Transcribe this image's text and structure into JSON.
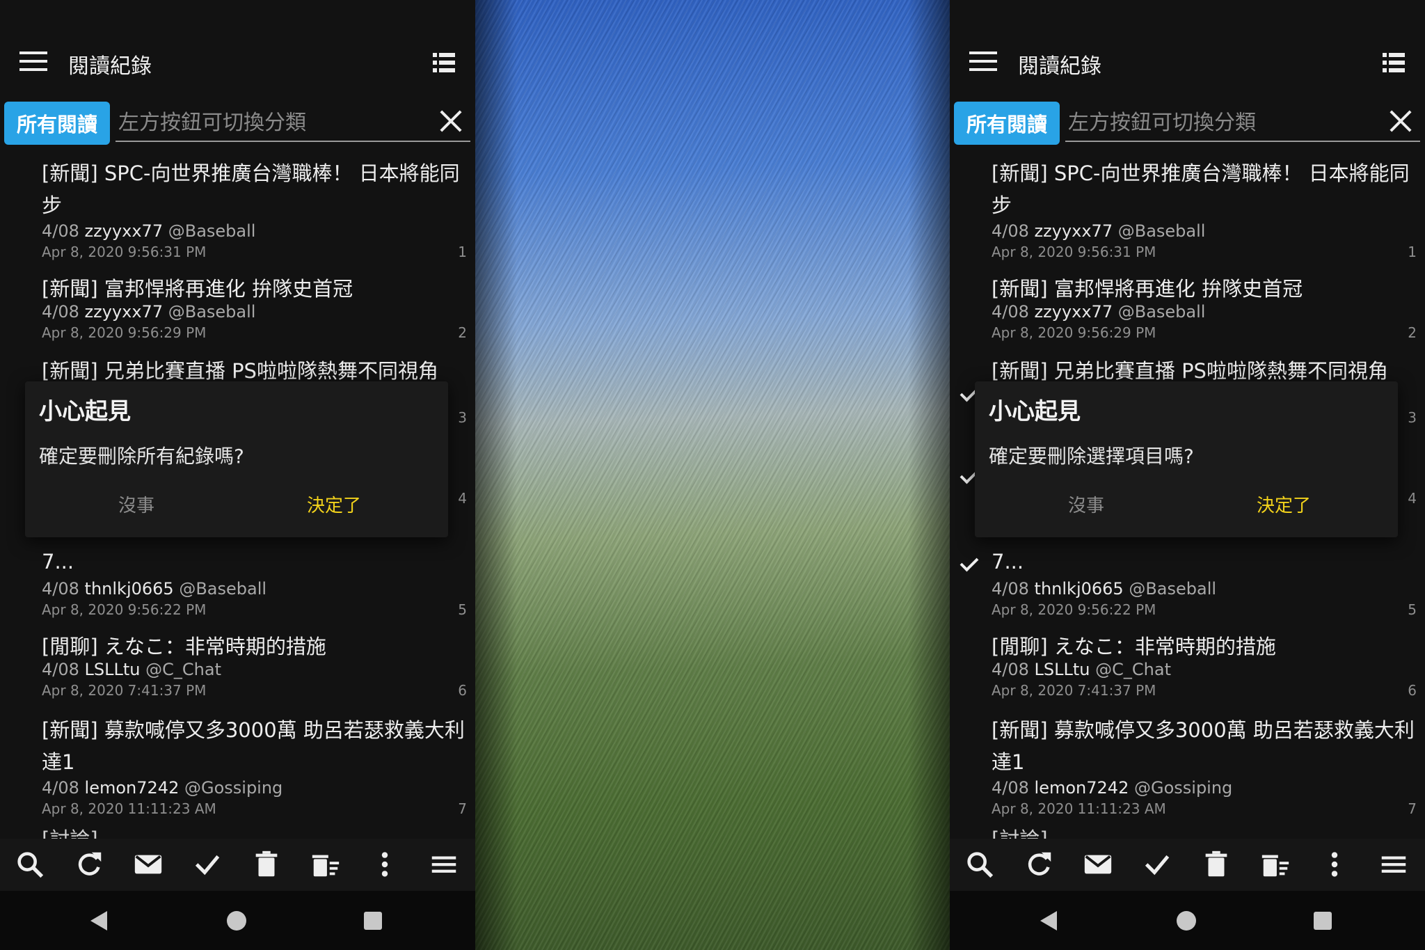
{
  "header": {
    "title": "閱讀紀錄"
  },
  "filter": {
    "category_label": "所有閱讀",
    "placeholder": "左方按鈕可切換分類"
  },
  "items": [
    {
      "title_line1": "[新聞] SPC-向世界推廣台灣職棒！ 日本將能同",
      "title_line2": "步",
      "date": "4/08",
      "author": "zzyyxx77",
      "board": "@Baseball",
      "time": "Apr 8, 2020 9:56:31 PM",
      "index": "1"
    },
    {
      "title_line1": "[新聞] 富邦悍將再進化 拚隊史首冠",
      "title_line2": "",
      "date": "4/08",
      "author": "zzyyxx77",
      "board": "@Baseball",
      "time": "Apr 8, 2020 9:56:29 PM",
      "index": "2"
    },
    {
      "title_line1": "[新聞] 兄弟比賽直播 PS啦啦隊熱舞不同視角",
      "title_line2": "",
      "date": "",
      "author": "",
      "board": "",
      "time": "",
      "index": "3"
    },
    {
      "title_line1": "",
      "title_line2": "",
      "date": "",
      "author": "",
      "board": "",
      "time": "",
      "index": "4"
    },
    {
      "title_line1": "",
      "title_line2": "7...",
      "date": "4/08",
      "author": "thnlkj0665",
      "board": "@Baseball",
      "time": "Apr 8, 2020 9:56:22 PM",
      "index": "5"
    },
    {
      "title_line1": "[閒聊] えなこ：非常時期的措施",
      "title_line2": "",
      "date": "4/08",
      "author": "LSLLtu",
      "board": "@C_Chat",
      "time": "Apr 8, 2020 7:41:37 PM",
      "index": "6"
    },
    {
      "title_line1": "[新聞] 募款喊停又多3000萬 助呂若瑟救義大利",
      "title_line2": "達1",
      "date": "4/08",
      "author": "lemon7242",
      "board": "@Gossiping",
      "time": "Apr 8, 2020 11:11:23 AM",
      "index": "7"
    }
  ],
  "dialogs": {
    "left": {
      "title": "小心起見",
      "message": "確定要刪除所有紀錄嗎?",
      "cancel": "沒事",
      "confirm": "決定了"
    },
    "right": {
      "title": "小心起見",
      "message": "確定要刪除選擇項目嗎?",
      "cancel": "沒事",
      "confirm": "決定了"
    }
  },
  "toolbar_icons": [
    "search-icon",
    "refresh-icon",
    "mail-icon",
    "check-icon",
    "delete-icon",
    "delete-sweep-icon",
    "more-vert-icon",
    "menu-icon"
  ],
  "colors": {
    "accent": "#29a3e6",
    "confirm": "#f2d21b",
    "background": "#121212"
  }
}
